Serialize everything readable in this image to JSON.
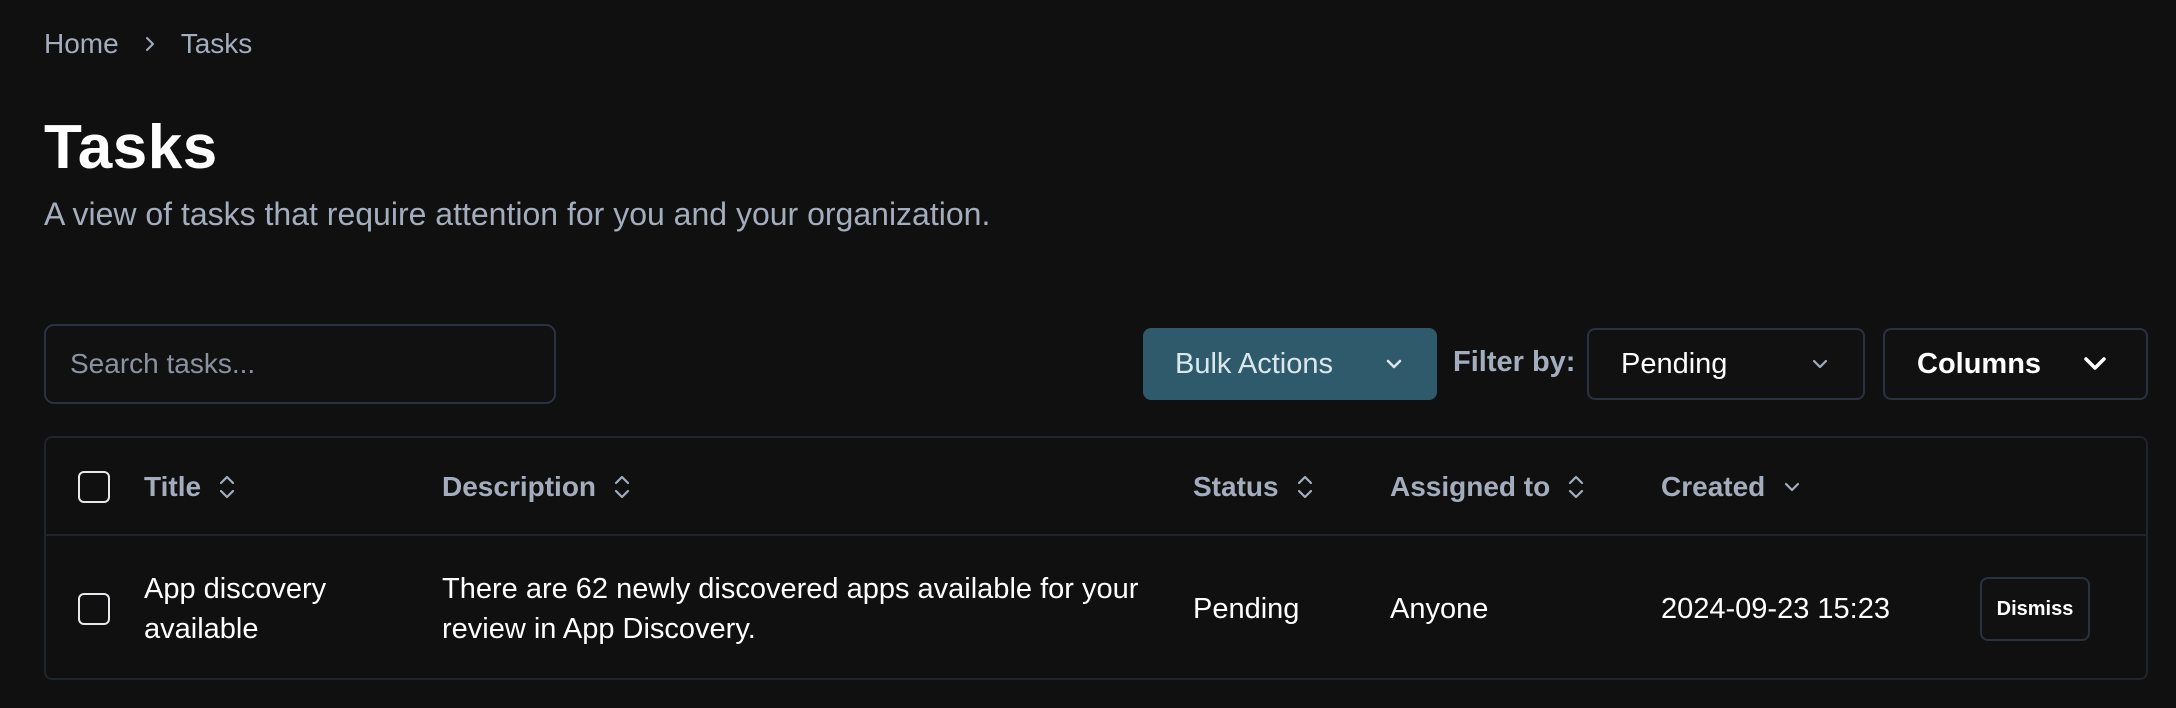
{
  "breadcrumb": {
    "items": [
      "Home",
      "Tasks"
    ]
  },
  "header": {
    "title": "Tasks",
    "subtitle": "A view of tasks that require attention for you and your organization."
  },
  "toolbar": {
    "search_placeholder": "Search tasks...",
    "bulk_actions_label": "Bulk Actions",
    "filter_label": "Filter by:",
    "filter_value": "Pending",
    "columns_label": "Columns"
  },
  "table": {
    "columns": [
      "Title",
      "Description",
      "Status",
      "Assigned to",
      "Created"
    ],
    "rows": [
      {
        "title": "App discovery available",
        "description": "There are 62 newly discovered apps available for your review in App Discovery.",
        "status": "Pending",
        "assigned_to": "Anyone",
        "created": "2024-09-23 15:23",
        "action_label": "Dismiss"
      }
    ]
  },
  "colors": {
    "background": "#101010",
    "muted_text": "#a3adbd",
    "border": "#2a3140",
    "accent_button": "#2f5a6b"
  },
  "icons": [
    "chevron-right-icon",
    "chevron-down-icon",
    "sort-icon",
    "checkbox"
  ]
}
